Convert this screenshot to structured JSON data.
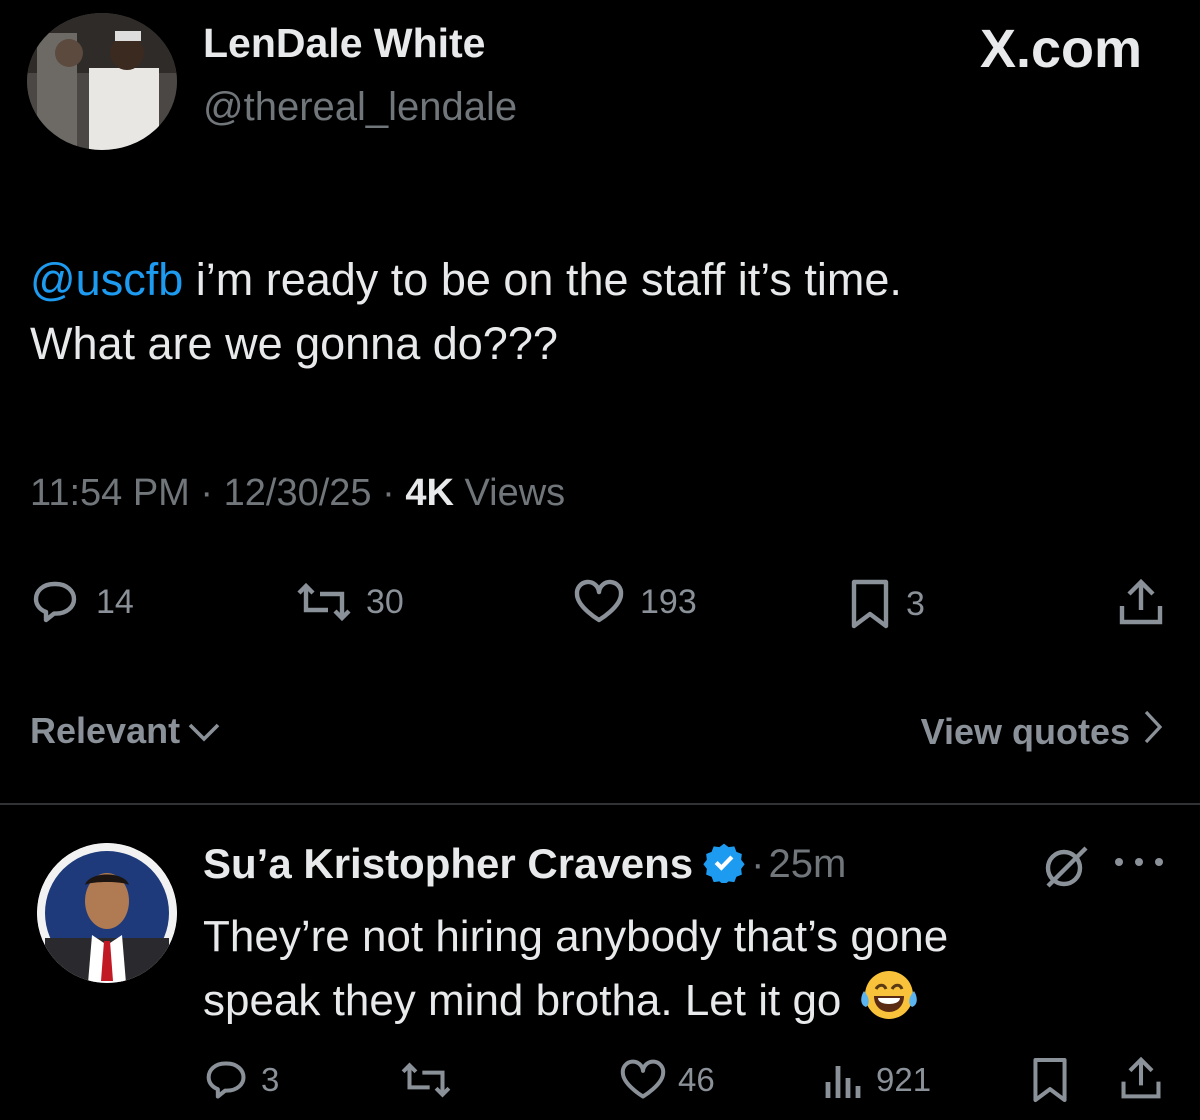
{
  "tweet": {
    "author_name": "LenDale White",
    "author_handle": "@thereal_lendale",
    "site_label": "X.com",
    "mention": "@uscfb",
    "text_line1": " i’m ready to be on the staff it’s time.",
    "text_line2": "What are we gonna do???",
    "time": "11:54 PM",
    "date": "12/30/25",
    "views_count": "4K",
    "views_label": "Views",
    "sep": "·",
    "replies": "14",
    "reposts": "30",
    "likes": "193",
    "bookmarks": "3"
  },
  "sort": {
    "label": "Relevant",
    "view_quotes": "View quotes"
  },
  "reply": {
    "author_name": "Su’a Kristopher Cravens",
    "age": "25m",
    "sep": "·",
    "text_line1": "They’re not hiring anybody that’s gone",
    "text_line2": "speak they mind brotha. Let it go",
    "replies": "3",
    "likes": "46",
    "views": "921"
  },
  "colors": {
    "background": "#000000",
    "text": "#e7e9ea",
    "muted": "#71767b",
    "link": "#1d9bf0",
    "verified": "#1d9bf0"
  },
  "icons": [
    "reply-icon",
    "repost-icon",
    "like-icon",
    "bookmark-icon",
    "share-icon",
    "chevron-down-icon",
    "chevron-right-icon",
    "verified-badge-icon",
    "grok-icon",
    "more-icon",
    "views-icon",
    "emoji-icon"
  ]
}
